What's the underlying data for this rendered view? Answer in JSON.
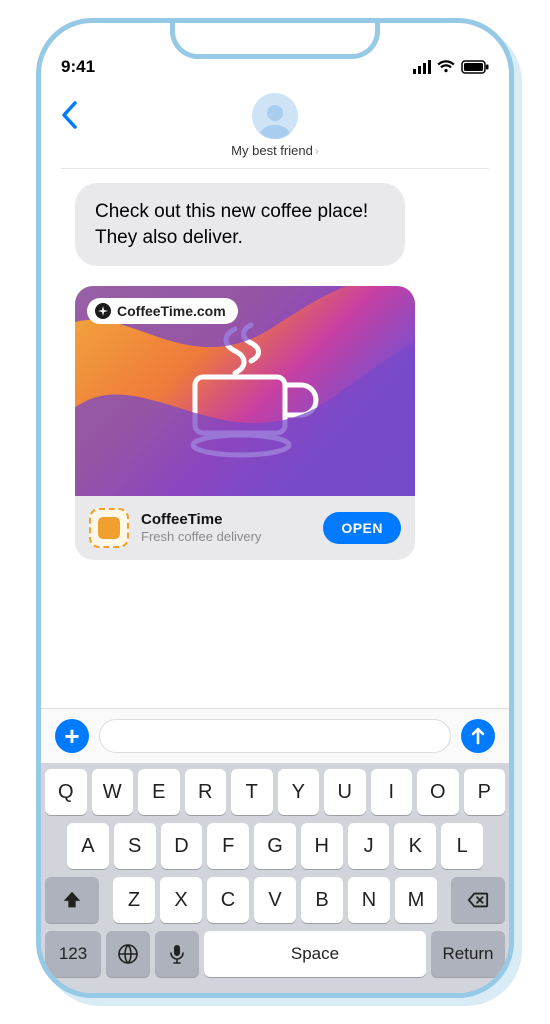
{
  "status": {
    "time": "9:41"
  },
  "header": {
    "contact_name": "My best friend"
  },
  "messages": {
    "incoming_text": "Check out this new coffee place! They also deliver."
  },
  "appclip": {
    "url_label": "CoffeeTime.com",
    "app_name": "CoffeeTime",
    "app_desc": "Fresh coffee delivery",
    "open_label": "OPEN"
  },
  "keyboard": {
    "row1": [
      "Q",
      "W",
      "E",
      "R",
      "T",
      "Y",
      "U",
      "I",
      "O",
      "P"
    ],
    "row2": [
      "A",
      "S",
      "D",
      "F",
      "G",
      "H",
      "J",
      "K",
      "L"
    ],
    "row3": [
      "Z",
      "X",
      "C",
      "V",
      "B",
      "N",
      "M"
    ],
    "numkey": "123",
    "space": "Space",
    "return": "Return"
  }
}
